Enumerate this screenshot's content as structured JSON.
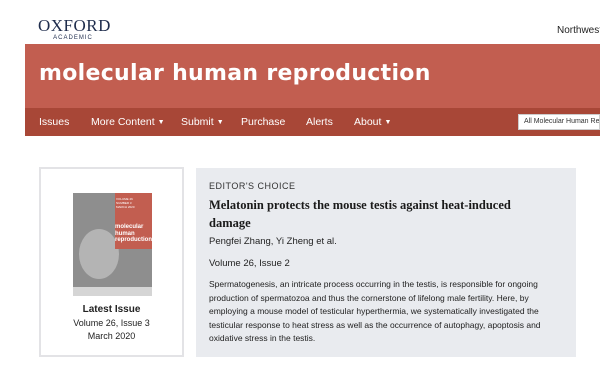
{
  "header": {
    "logo_main": "OXFORD",
    "logo_sub": "ACADEMIC",
    "institution": "Northwestern"
  },
  "banner": {
    "journal_title": "molecular human reproduction"
  },
  "nav": {
    "items": [
      {
        "label": "Issues",
        "has_menu": false
      },
      {
        "label": "More Content",
        "has_menu": true
      },
      {
        "label": "Submit",
        "has_menu": true
      },
      {
        "label": "Purchase",
        "has_menu": false
      },
      {
        "label": "Alerts",
        "has_menu": false
      },
      {
        "label": "About",
        "has_menu": true
      }
    ],
    "caret": "▼",
    "search_scope": "All Molecular Human Reproduction"
  },
  "latest_issue": {
    "heading": "Latest Issue",
    "volume": "Volume 26, Issue 3",
    "date": "March 2020",
    "cover_title": "molecular human reproduction"
  },
  "editors_choice": {
    "label": "EDITOR'S CHOICE",
    "title": "Melatonin protects the mouse testis against heat-induced damage",
    "authors": "Pengfei Zhang, Yi Zheng et al.",
    "volume": "Volume 26, Issue 2",
    "abstract": "Spermatogenesis, an intricate process occurring in the testis, is responsible for ongoing production of spermatozoa and thus the cornerstone of lifelong male fertility. Here, by employing a mouse model of testicular hyperthermia, we systematically investigated the testicular response to heat stress as well as the occurrence of autophagy, apoptosis and oxidative stress in the testis."
  },
  "colors": {
    "banner": "#c25e50",
    "nav": "#a84737",
    "card_bg": "#e9ebef"
  }
}
